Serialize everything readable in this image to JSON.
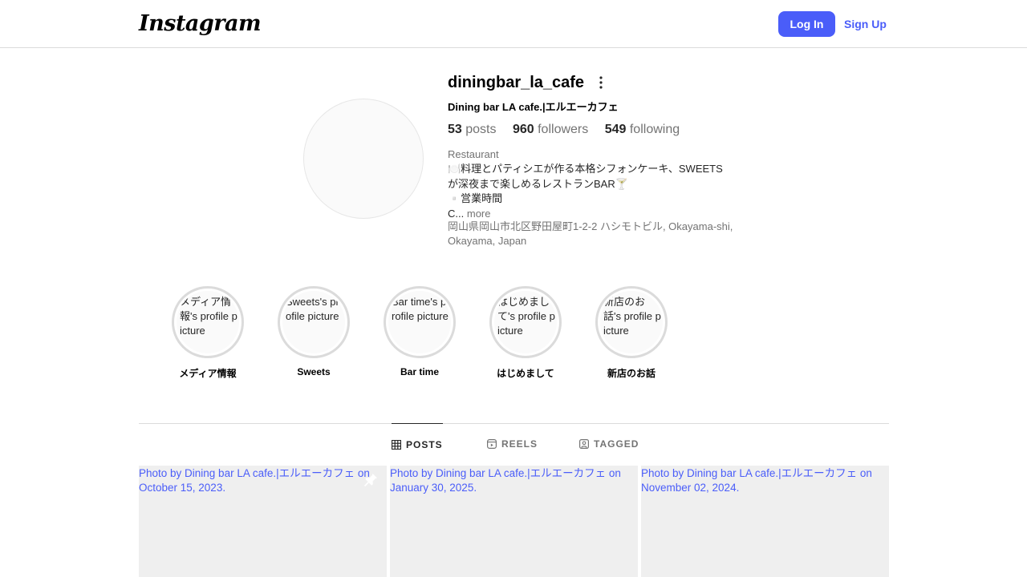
{
  "header": {
    "logo_text": "Instagram",
    "login_label": "Log In",
    "signup_label": "Sign Up",
    "accent_color": "#4a5df9"
  },
  "profile": {
    "username": "diningbar_la_cafe",
    "full_name": "Dining bar LA cafe.|エルエーカフェ",
    "stats": {
      "posts_count": "53",
      "posts_label": "posts",
      "followers_count": "960",
      "followers_label": "followers",
      "following_count": "549",
      "following_label": "following"
    },
    "category": "Restaurant",
    "bio_lines": [
      "🍽️料理とパティシエが作る本格シフォンケーキ、SWEETS",
      "が深夜まで楽しめるレストランBAR🍸",
      "▫️営業時間"
    ],
    "bio_truncated": "C...",
    "bio_more_label": "more",
    "address": "岡山県岡山市北区野田屋町1-2-2 ハシモトビル, Okayama-shi, Okayama, Japan"
  },
  "highlights": [
    {
      "label": "メディア情報",
      "alt": "メディア情報's profile picture"
    },
    {
      "label": "Sweets",
      "alt": "Sweets's profile picture"
    },
    {
      "label": "Bar time",
      "alt": "Bar time's profile picture"
    },
    {
      "label": "はじめまして",
      "alt": "はじめまして's profile picture"
    },
    {
      "label": "新店のお話",
      "alt": "新店のお話's profile picture"
    }
  ],
  "tabs": [
    {
      "label": "POSTS",
      "icon": "grid-icon",
      "active": true
    },
    {
      "label": "REELS",
      "icon": "reels-icon",
      "active": false
    },
    {
      "label": "TAGGED",
      "icon": "tagged-icon",
      "active": false
    }
  ],
  "posts": [
    {
      "alt": "Photo by Dining bar LA cafe.|エルエーカフェ on October 15, 2023.",
      "pinned": true
    },
    {
      "alt": "Photo by Dining bar LA cafe.|エルエーカフェ on January 30, 2025.",
      "pinned": false
    },
    {
      "alt": "Photo by Dining bar LA cafe.|エルエーカフェ on November 02, 2024.",
      "pinned": false
    }
  ]
}
